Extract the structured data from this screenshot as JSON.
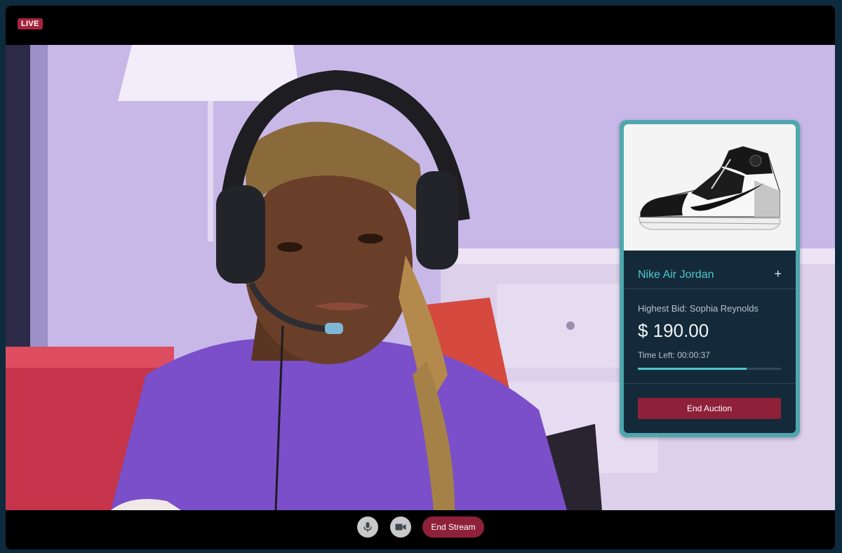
{
  "header": {
    "live_badge": "LIVE"
  },
  "auction": {
    "product_name": "Nike Air Jordan",
    "expand_icon": "+",
    "highest_bid": "Highest Bid: Sophia Reynolds",
    "amount": "$ 190.00",
    "time_left": "Time Left: 00:00:37",
    "progress": 0.76,
    "end_button": "End Auction",
    "accent_color": "#4ec9cf"
  },
  "controls": {
    "mic_icon": "microphone-icon",
    "camera_icon": "video-camera-icon",
    "end_stream": "End Stream"
  }
}
